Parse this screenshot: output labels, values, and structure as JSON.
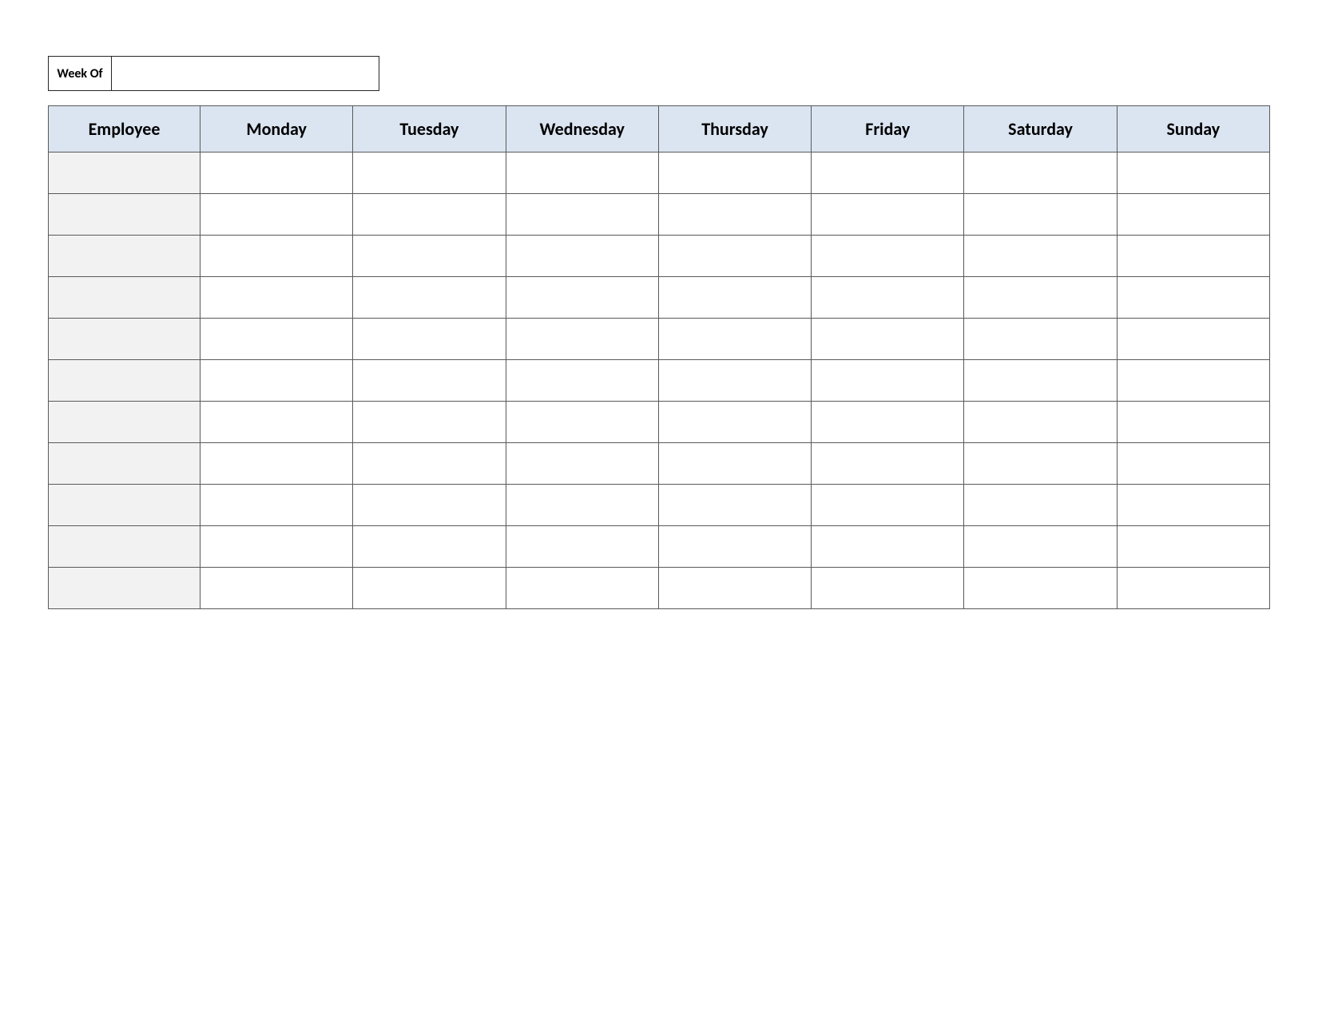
{
  "weekof": {
    "label": "Week Of",
    "value": ""
  },
  "table": {
    "headers": [
      "Employee",
      "Monday",
      "Tuesday",
      "Wednesday",
      "Thursday",
      "Friday",
      "Saturday",
      "Sunday"
    ],
    "rows": [
      {
        "employee": "",
        "cells": [
          "",
          "",
          "",
          "",
          "",
          "",
          ""
        ]
      },
      {
        "employee": "",
        "cells": [
          "",
          "",
          "",
          "",
          "",
          "",
          ""
        ]
      },
      {
        "employee": "",
        "cells": [
          "",
          "",
          "",
          "",
          "",
          "",
          ""
        ]
      },
      {
        "employee": "",
        "cells": [
          "",
          "",
          "",
          "",
          "",
          "",
          ""
        ]
      },
      {
        "employee": "",
        "cells": [
          "",
          "",
          "",
          "",
          "",
          "",
          ""
        ]
      },
      {
        "employee": "",
        "cells": [
          "",
          "",
          "",
          "",
          "",
          "",
          ""
        ]
      },
      {
        "employee": "",
        "cells": [
          "",
          "",
          "",
          "",
          "",
          "",
          ""
        ]
      },
      {
        "employee": "",
        "cells": [
          "",
          "",
          "",
          "",
          "",
          "",
          ""
        ]
      },
      {
        "employee": "",
        "cells": [
          "",
          "",
          "",
          "",
          "",
          "",
          ""
        ]
      },
      {
        "employee": "",
        "cells": [
          "",
          "",
          "",
          "",
          "",
          "",
          ""
        ]
      },
      {
        "employee": "",
        "cells": [
          "",
          "",
          "",
          "",
          "",
          "",
          ""
        ]
      }
    ]
  }
}
